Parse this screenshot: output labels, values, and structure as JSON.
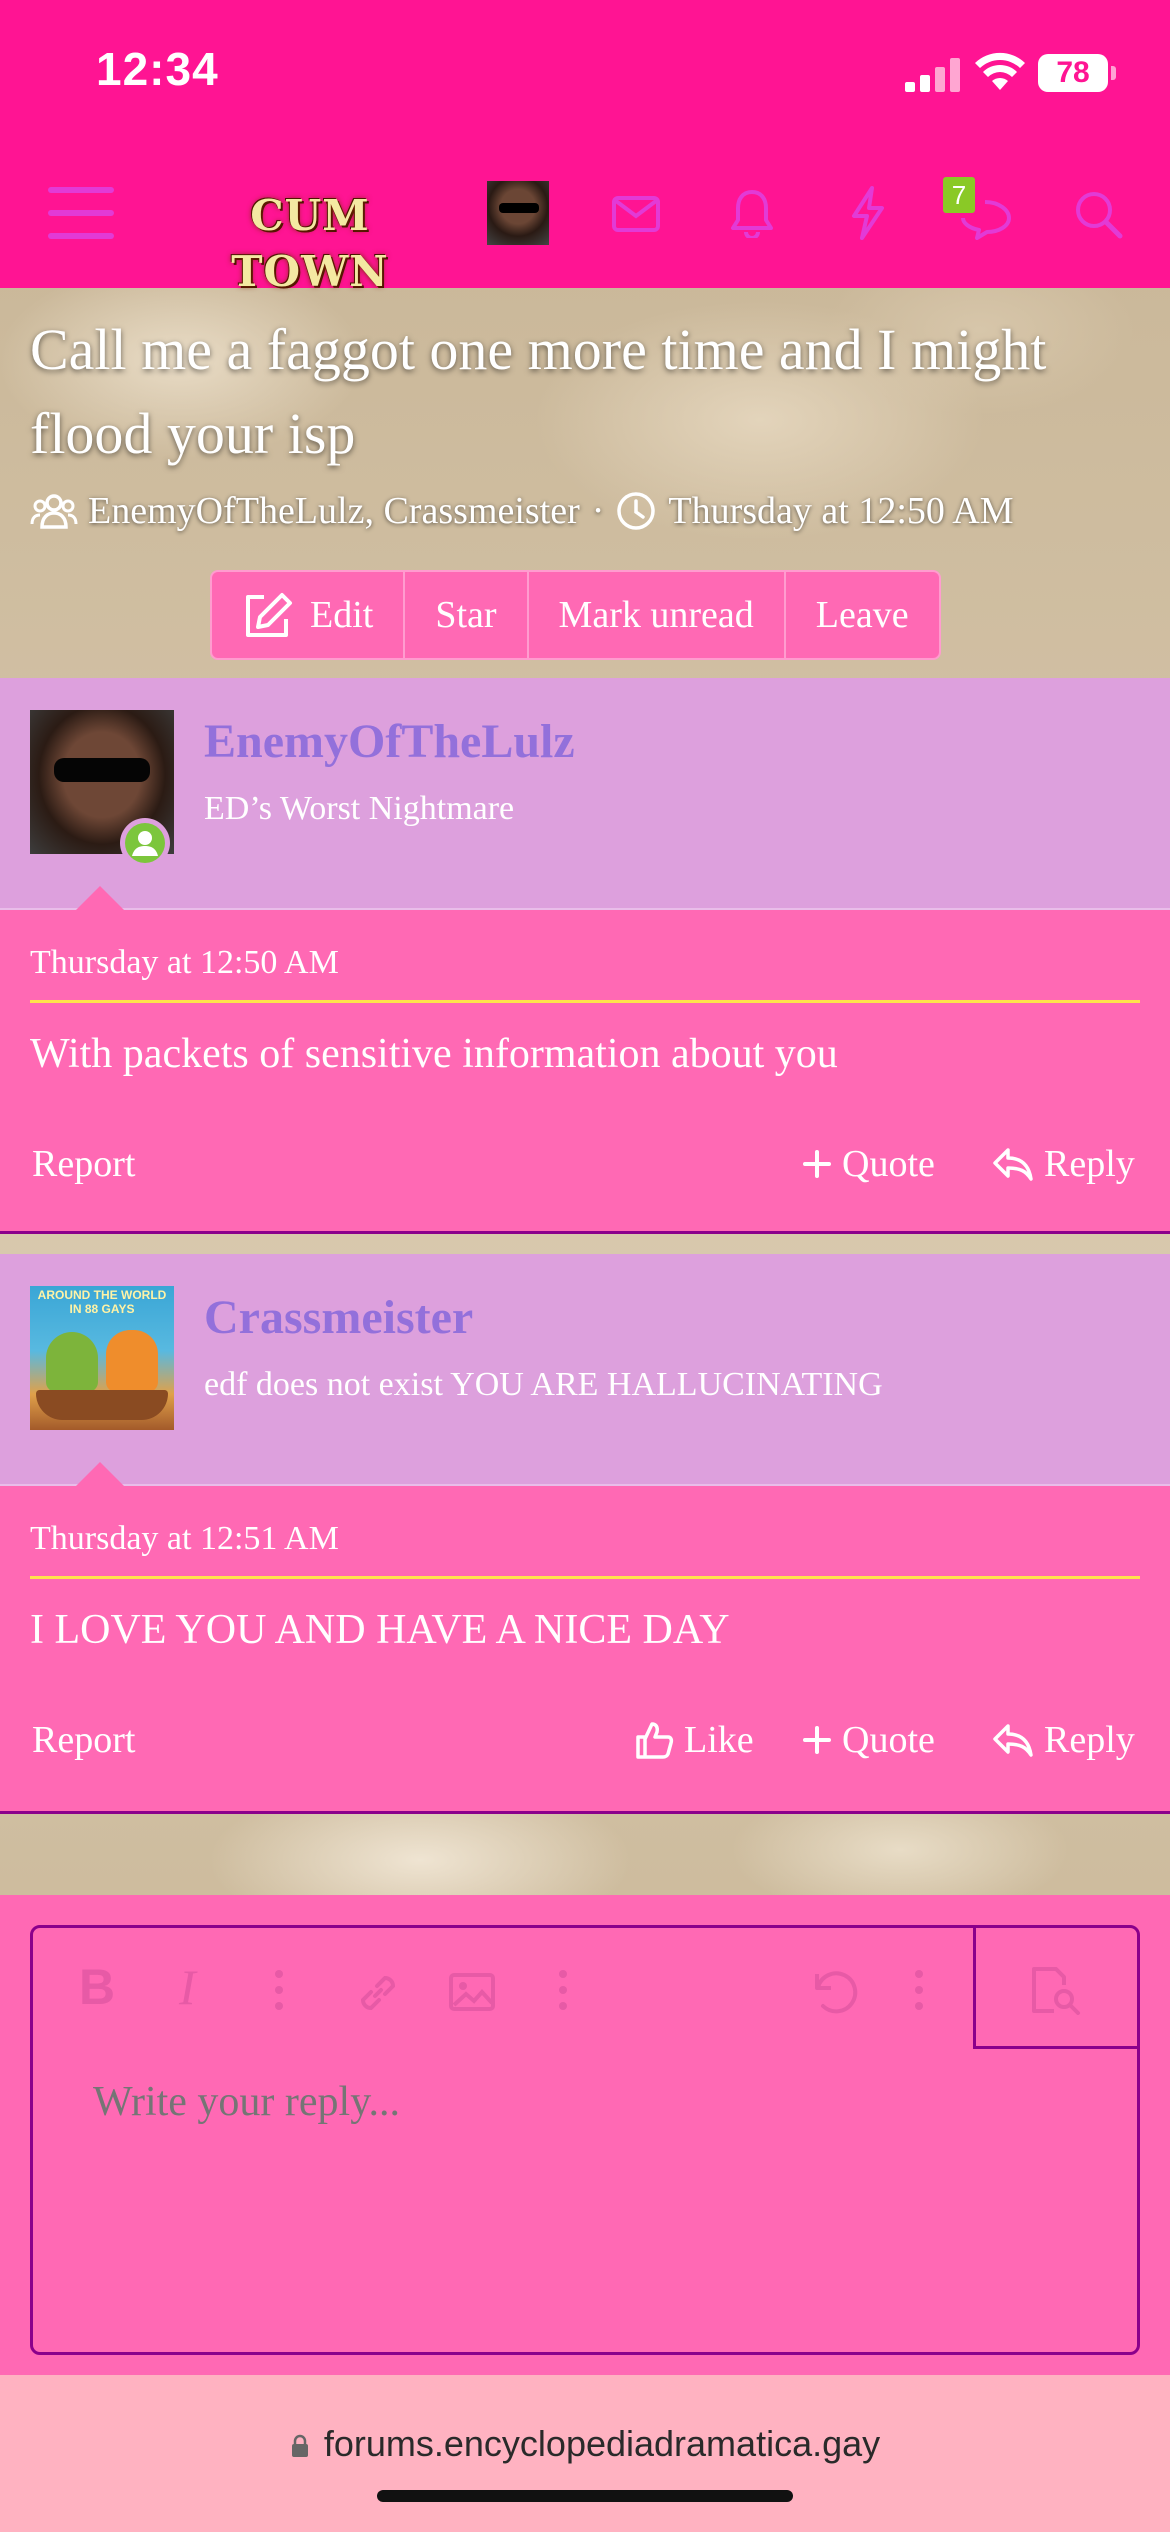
{
  "status_bar": {
    "time": "12:34",
    "battery": "78"
  },
  "navbar": {
    "logo_text": "CUM TOWN",
    "conversations_badge": "7",
    "icons": [
      "menu-icon",
      "avatar",
      "mail-icon",
      "bell-icon",
      "bolt-icon",
      "chat-icon",
      "search-icon"
    ]
  },
  "thread": {
    "title": "Call me a faggot one more time and I might flood your isp",
    "participants": "EnemyOfTheLulz, Crassmeister",
    "separator": "·",
    "date": "Thursday at 12:50 AM",
    "buttons": {
      "edit": "Edit",
      "star": "Star",
      "mark_unread": "Mark unread",
      "leave": "Leave"
    }
  },
  "posts": [
    {
      "username": "EnemyOfTheLulz",
      "user_title": "ED’s Worst Nightmare",
      "date": "Thursday at 12:50 AM",
      "message": "With packets of sensitive information about you",
      "actions": {
        "report": "Report",
        "quote": "Quote",
        "reply": "Reply"
      }
    },
    {
      "username": "Crassmeister",
      "user_title": "edf does not exist YOU ARE HALLUCINATING",
      "avatar_caption": "AROUND THE WORLD IN 88 GAYS",
      "date": "Thursday at 12:51 AM",
      "message": "I LOVE YOU AND HAVE A NICE DAY",
      "actions": {
        "report": "Report",
        "like": "Like",
        "quote": "Quote",
        "reply": "Reply"
      }
    }
  ],
  "editor": {
    "placeholder": "Write your reply..."
  },
  "browser": {
    "url": "forums.encyclopediadramatica.gay"
  },
  "colors": {
    "primary_pink": "#ff1493",
    "post_pink": "#ff69b4",
    "user_bar": "#dda0dd",
    "username": "#9370db",
    "divider_yellow": "#ffe34d"
  }
}
